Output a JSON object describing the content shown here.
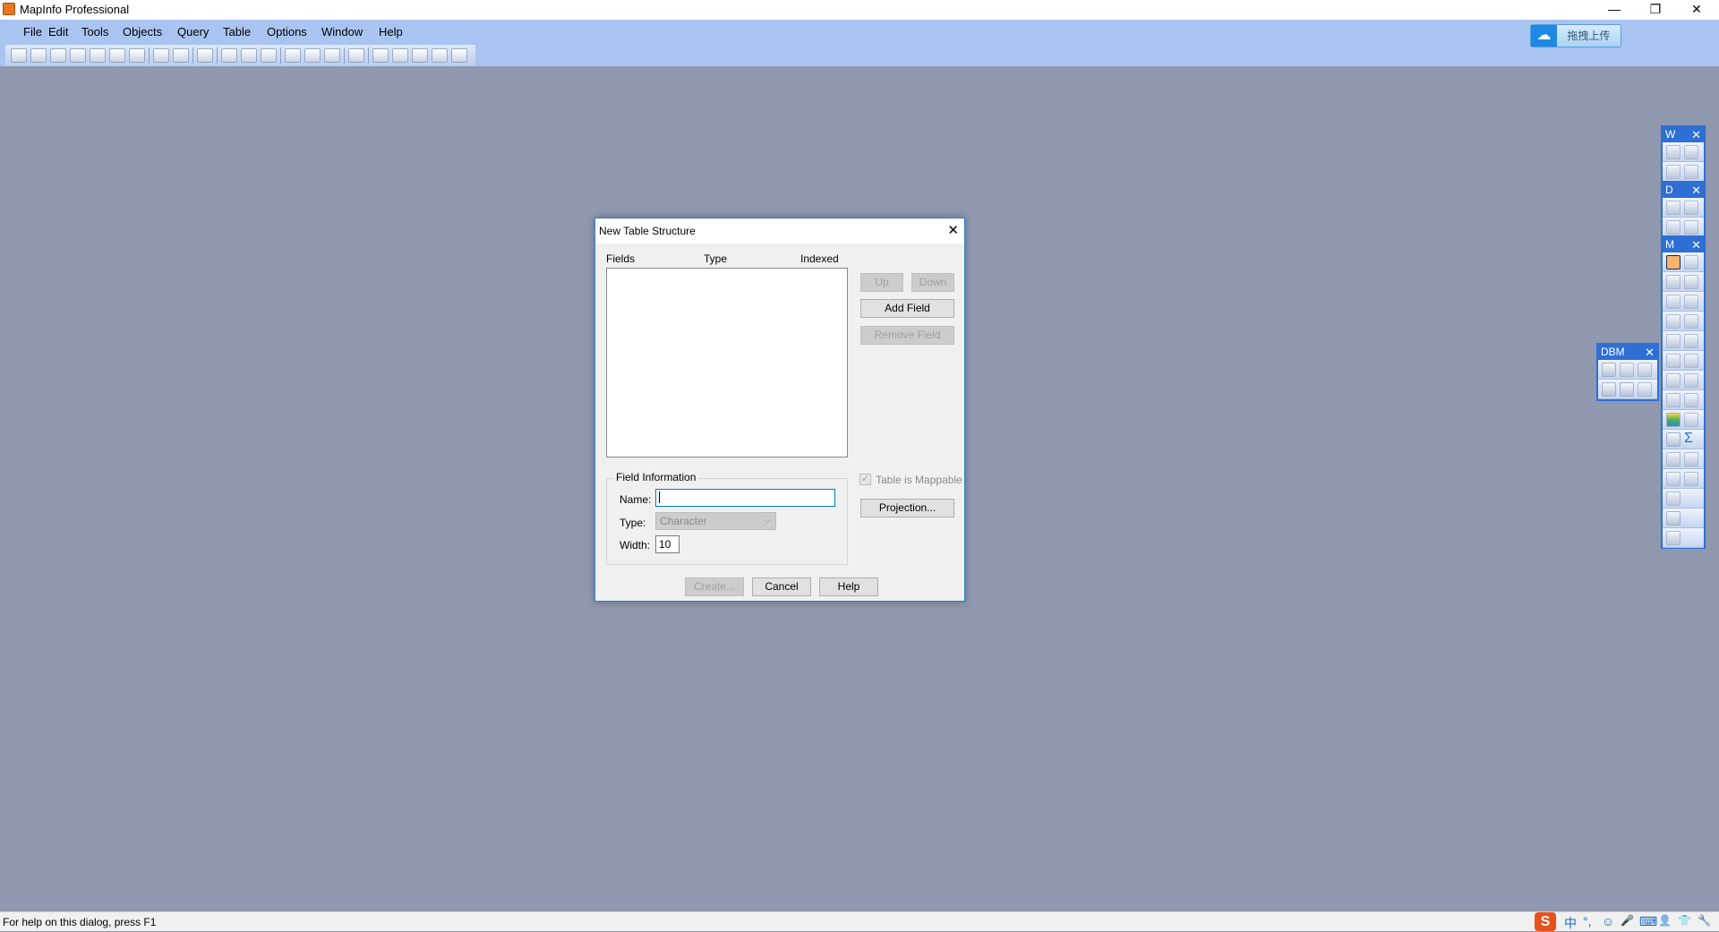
{
  "window": {
    "title": "MapInfo Professional",
    "minimize": "—",
    "restore": "❐",
    "close": "✕"
  },
  "menu": [
    "File",
    "Edit",
    "Tools",
    "Objects",
    "Query",
    "Table",
    "Options",
    "Window",
    "Help"
  ],
  "upload_button": {
    "label": "拖拽上传",
    "icon": "cloud-icon"
  },
  "dialog": {
    "title": "New Table Structure",
    "close": "✕",
    "columns": [
      "Fields",
      "Type",
      "Indexed"
    ],
    "fields": [],
    "buttons": {
      "up": "Up",
      "down": "Down",
      "add_field": "Add Field",
      "remove_field": "Remove Field",
      "projection": "Projection...",
      "create": "Create...",
      "cancel": "Cancel",
      "help": "Help"
    },
    "field_info": {
      "legend": "Field Information",
      "name_label": "Name:",
      "name_value": "",
      "type_label": "Type:",
      "type_value": "Character",
      "width_label": "Width:",
      "width_value": "10"
    },
    "mappable": {
      "label": "Table is Mappable",
      "checked": true
    }
  },
  "panels": {
    "w": "W",
    "d": "D",
    "m": "M",
    "dbm": "DBM",
    "close": "✕"
  },
  "status": {
    "text": "For help on this dialog, press F1"
  },
  "tray": [
    "中",
    "°,",
    "☺",
    "🎤",
    "⌨",
    "👤",
    "👕",
    "🔧"
  ]
}
